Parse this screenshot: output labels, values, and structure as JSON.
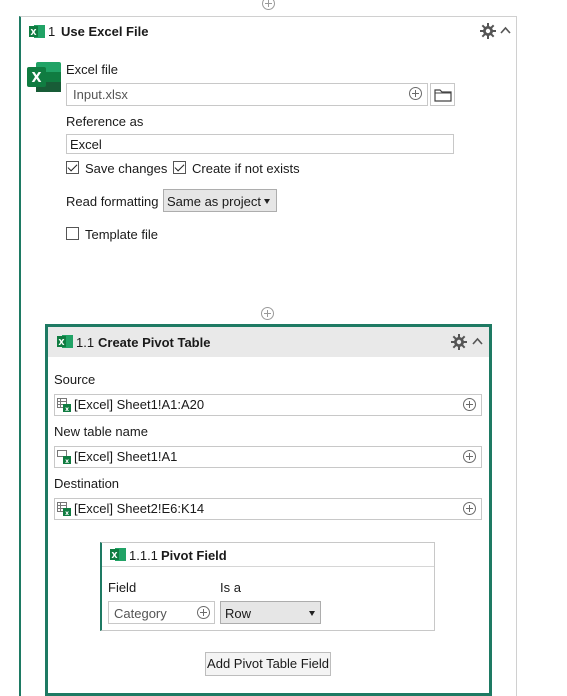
{
  "top_step": {
    "number": "1",
    "title": "Use Excel File",
    "excel_file_label": "Excel file",
    "excel_file_value": "Input.xlsx",
    "reference_label": "Reference as",
    "reference_value": "Excel",
    "save_changes_label": "Save changes",
    "save_changes_checked": true,
    "create_if_not_exists_label": "Create if not exists",
    "create_if_not_exists_checked": true,
    "read_formatting_label": "Read formatting",
    "read_formatting_value": "Same as project",
    "template_file_label": "Template file",
    "template_file_checked": false
  },
  "pivot_step": {
    "number": "1.1",
    "title": "Create Pivot Table",
    "source_label": "Source",
    "source_value": "[Excel] Sheet1!A1:A20",
    "new_table_label": "New table name",
    "new_table_value": "[Excel] Sheet1!A1",
    "destination_label": "Destination",
    "destination_value": "[Excel] Sheet2!E6:K14"
  },
  "pivot_field": {
    "number": "1.1.1",
    "title": "Pivot Field",
    "field_label": "Field",
    "field_value": "Category",
    "is_a_label": "Is a",
    "is_a_value": "Row"
  },
  "add_field_button": "Add Pivot Table Field",
  "colors": {
    "accent_green": "#1e7a63",
    "excel_green": "#1d6f42",
    "header_gray": "#e9e9e9"
  }
}
